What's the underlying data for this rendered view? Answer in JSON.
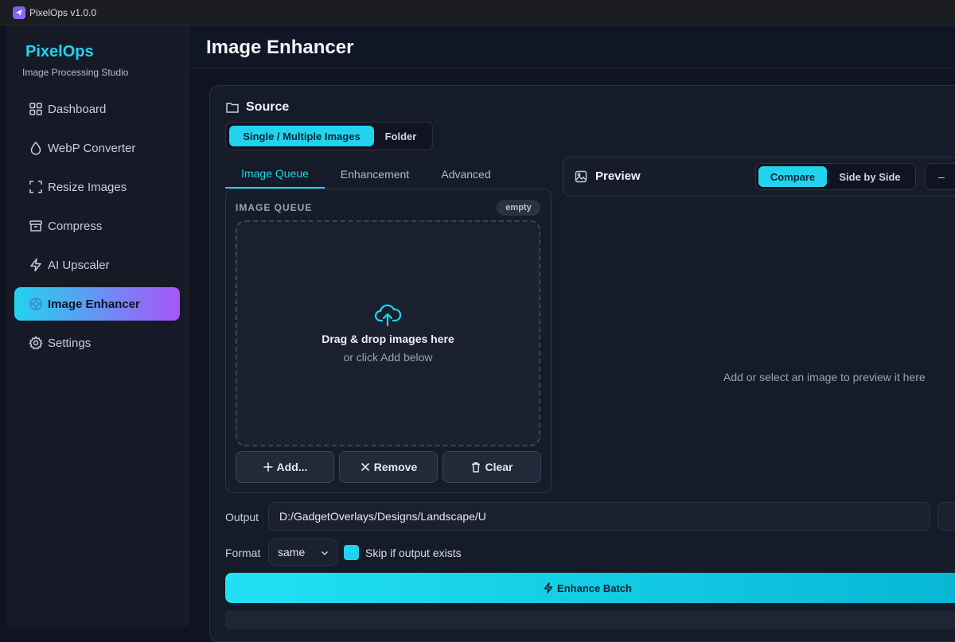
{
  "window": {
    "title": "PixelOps v1.0.0"
  },
  "sidebar": {
    "brand": "PixelOps",
    "subtitle": "Image Processing Studio",
    "items": [
      {
        "label": "Dashboard",
        "icon": "grid-icon"
      },
      {
        "label": "WebP Converter",
        "icon": "drop-icon"
      },
      {
        "label": "Resize Images",
        "icon": "crop-frame-icon"
      },
      {
        "label": "Compress",
        "icon": "archive-icon"
      },
      {
        "label": "AI Upscaler",
        "icon": "bolt-icon"
      },
      {
        "label": "Image Enhancer",
        "icon": "sun-icon",
        "active": true
      },
      {
        "label": "Settings",
        "icon": "gear-icon"
      }
    ]
  },
  "header": {
    "title": "Image Enhancer"
  },
  "source": {
    "heading": "Source",
    "modes": [
      "Single / Multiple Images",
      "Folder"
    ],
    "selected_mode": "Single / Multiple Images"
  },
  "tabs": {
    "items": [
      "Image Queue",
      "Enhancement",
      "Advanced"
    ],
    "active": "Image Queue"
  },
  "queue": {
    "label": "IMAGE QUEUE",
    "badge": "empty",
    "drop_title": "Drag & drop images here",
    "drop_subtitle": "or click Add below",
    "add_label": "Add...",
    "remove_label": "Remove",
    "clear_label": "Clear"
  },
  "preview": {
    "title": "Preview",
    "modes": [
      "Compare",
      "Side by Side"
    ],
    "selected_mode": "Compare",
    "zoom_label": "–",
    "empty_message": "Add or select an image to preview it here"
  },
  "output": {
    "label": "Output",
    "path": "D:/GadgetOverlays/Designs/Landscape/U"
  },
  "format": {
    "label": "Format",
    "value": "same",
    "skip_label": "Skip if output exists",
    "skip_checked": true
  },
  "actions": {
    "enhance_label": "Enhance Batch"
  },
  "colors": {
    "accent": "#22d3ee",
    "accent2": "#a855f7",
    "background": "#0f1420",
    "panel": "#151b29"
  }
}
